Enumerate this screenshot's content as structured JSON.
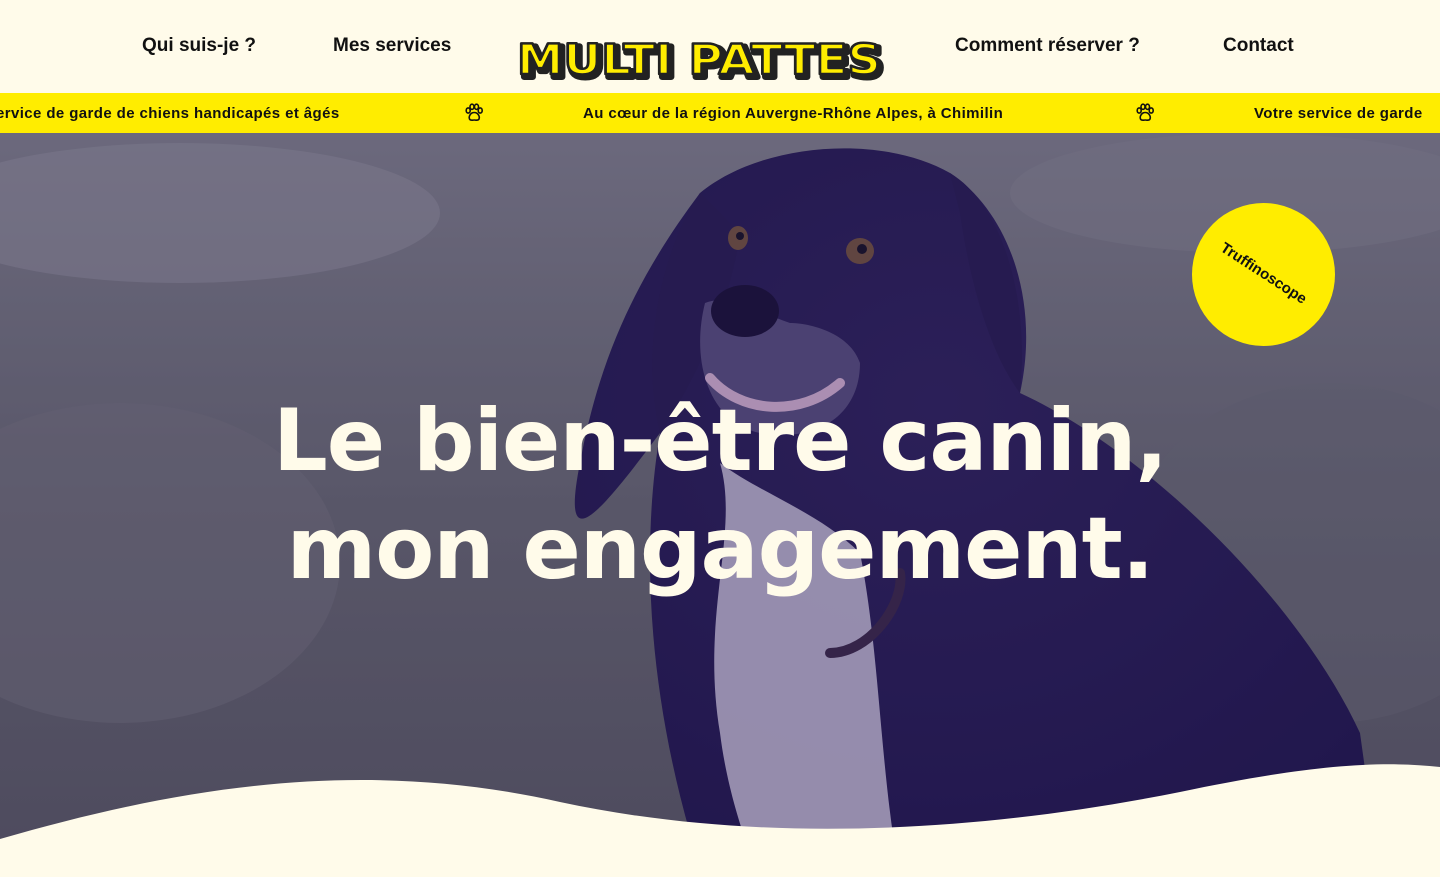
{
  "nav": {
    "links": [
      "Qui suis-je ?",
      "Mes services",
      "Comment réserver ?",
      "Contact"
    ],
    "logo_text": "MULTI PATTES"
  },
  "marquee": {
    "items": [
      "ervice de garde de chiens handicapés et âgés",
      "Au cœur de la région Auvergne-Rhône Alpes, à Chimilin",
      "Votre service de garde"
    ],
    "separator_icon": "paw-icon"
  },
  "hero": {
    "title_line1": "Le bien-être canin,",
    "title_line2": "mon engagement.",
    "badge": "Truffinoscope"
  },
  "colors": {
    "cream": "#fffbea",
    "yellow": "#ffed00",
    "text": "#111111",
    "overlay": "#2a1a6b"
  }
}
